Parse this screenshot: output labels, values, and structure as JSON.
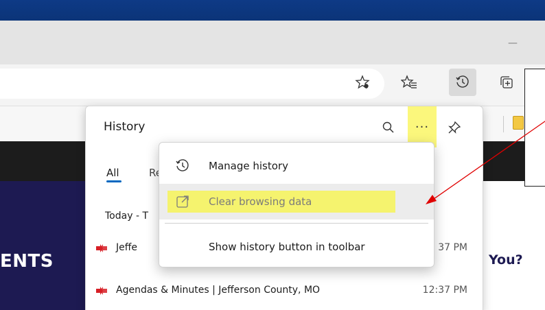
{
  "browser": {
    "minimize_glyph": "—",
    "toolbar_icons": [
      "favorite-add-icon",
      "favorites-icon",
      "history-icon",
      "collections-icon"
    ]
  },
  "page": {
    "hero_text": "ENTS",
    "right_text": "You?"
  },
  "history": {
    "title": "History",
    "tabs": [
      {
        "label": "All",
        "selected": true
      },
      {
        "label": "Re",
        "selected": false
      }
    ],
    "section_label": "Today - T",
    "rows": [
      {
        "title": "Jeffe",
        "time": "37 PM"
      },
      {
        "title": "Agendas & Minutes | Jefferson County, MO",
        "time": "12:37 PM"
      }
    ],
    "more_label": "···"
  },
  "menu": {
    "items": [
      {
        "label": "Manage history",
        "icon": "history-icon"
      },
      {
        "label": "Clear browsing data",
        "icon": "clear-data-icon",
        "highlighted": true
      },
      {
        "label": "Show history button in toolbar",
        "icon": ""
      }
    ]
  },
  "colors": {
    "highlight": "#f5f36e",
    "arrow": "#e00000",
    "accent": "#0067c0",
    "favicon": "#d71f26"
  }
}
